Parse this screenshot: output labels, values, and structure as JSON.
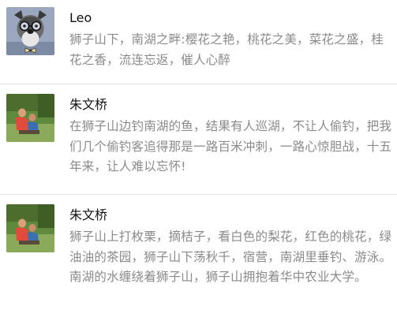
{
  "comments": [
    {
      "name": "Leo",
      "avatar_icon": "schnauzer-dog-glasses-avatar",
      "text": "狮子山下，南湖之畔:樱花之艳，桃花之美，菜花之盛，桂花之香，流连忘返，催人心醉"
    },
    {
      "name": "朱文桥",
      "avatar_icon": "outdoor-photo-avatar",
      "text": "在狮子山边钓南湖的鱼，结果有人巡湖，不让人偷钓，把我们几个偷钓客追得那是一路百米冲刺，一路心惊胆战，十五年来，让人难以忘怀!"
    },
    {
      "name": "朱文桥",
      "avatar_icon": "outdoor-photo-avatar",
      "text": "狮子山上打枚栗，摘桔子，看白色的梨花，红色的桃花，绿油油的茶园，狮子山下荡秋千，宿营，南湖里垂钓、游泳。南湖的水缠绕着狮子山，狮子山拥抱着华中农业大学。"
    }
  ]
}
